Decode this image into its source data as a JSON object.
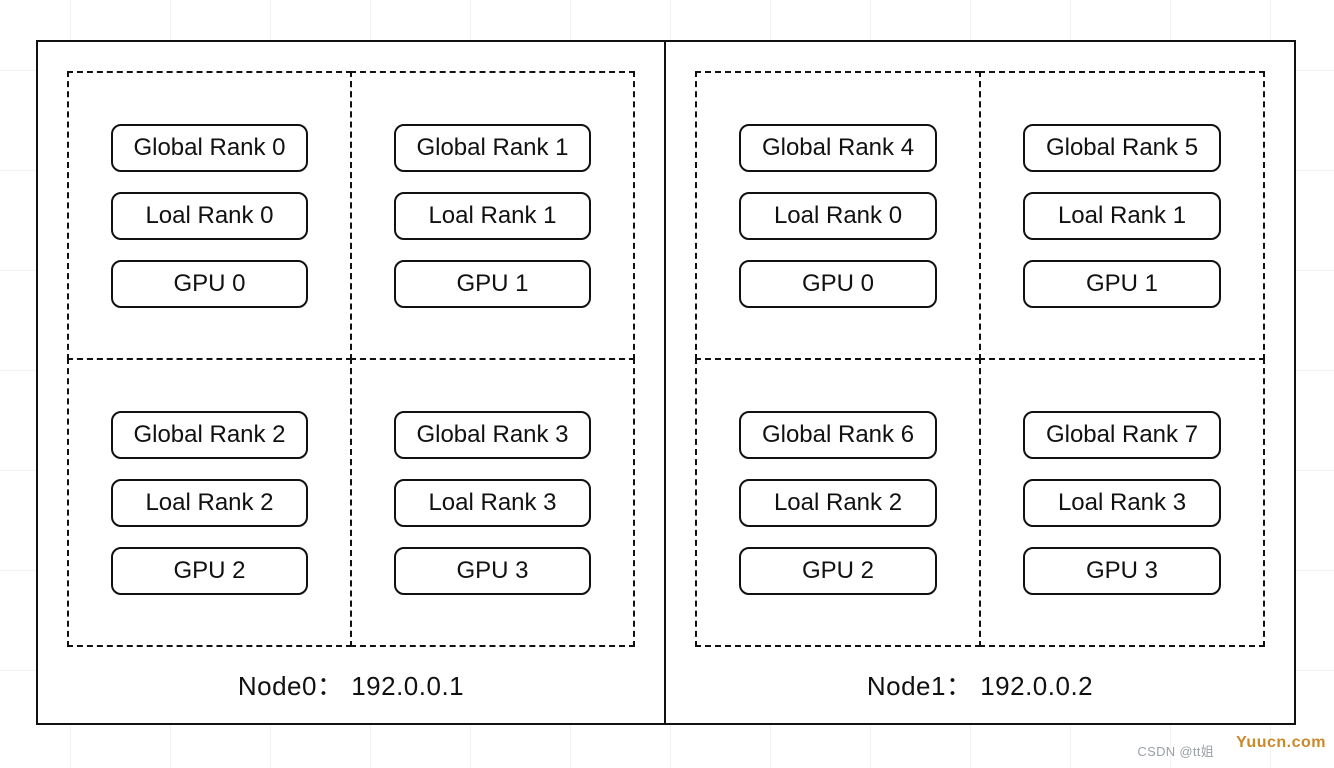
{
  "nodes": [
    {
      "label": "Node0：  192.0.0.1",
      "gpus": [
        {
          "global": "Global Rank 0",
          "local": "Loal Rank 0",
          "gpu": "GPU 0"
        },
        {
          "global": "Global Rank 1",
          "local": "Loal Rank 1",
          "gpu": "GPU 1"
        },
        {
          "global": "Global Rank 2",
          "local": "Loal Rank 2",
          "gpu": "GPU 2"
        },
        {
          "global": "Global Rank 3",
          "local": "Loal Rank 3",
          "gpu": "GPU 3"
        }
      ]
    },
    {
      "label": "Node1：  192.0.0.2",
      "gpus": [
        {
          "global": "Global Rank 4",
          "local": "Loal Rank 0",
          "gpu": "GPU 0"
        },
        {
          "global": "Global Rank 5",
          "local": "Loal Rank 1",
          "gpu": "GPU 1"
        },
        {
          "global": "Global Rank 6",
          "local": "Loal Rank 2",
          "gpu": "GPU 2"
        },
        {
          "global": "Global Rank 7",
          "local": "Loal Rank 3",
          "gpu": "GPU 3"
        }
      ]
    }
  ],
  "attribution": "CSDN @tt姐",
  "watermark": "Yuucn.com"
}
